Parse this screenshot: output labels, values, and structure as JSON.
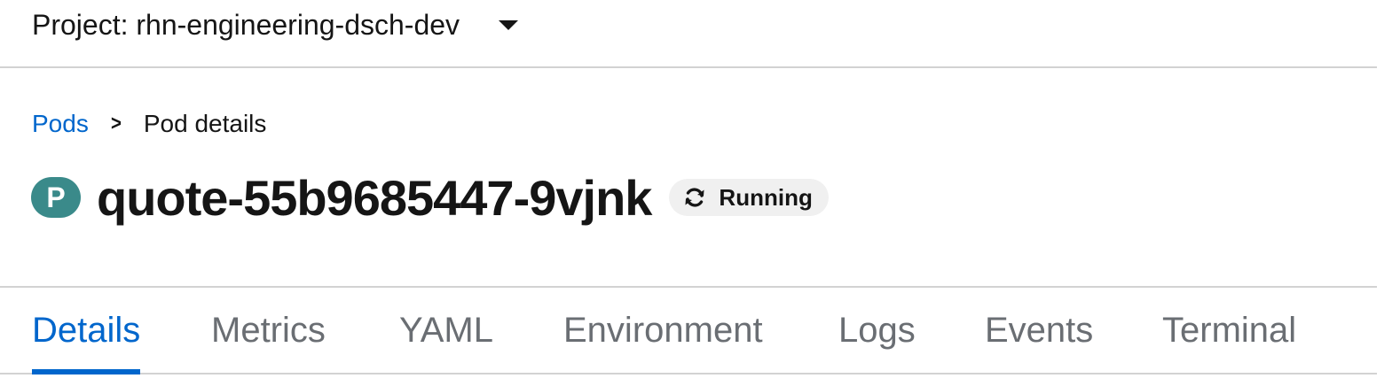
{
  "project": {
    "label": "Project: rhn-engineering-dsch-dev"
  },
  "breadcrumb": {
    "parent": "Pods",
    "current": "Pod details"
  },
  "resource": {
    "badge": "P",
    "name": "quote-55b9685447-9vjnk",
    "status": "Running",
    "badge_color": "#3a8a8a"
  },
  "tabs": [
    {
      "label": "Details",
      "active": true
    },
    {
      "label": "Metrics",
      "active": false
    },
    {
      "label": "YAML",
      "active": false
    },
    {
      "label": "Environment",
      "active": false
    },
    {
      "label": "Logs",
      "active": false
    },
    {
      "label": "Events",
      "active": false
    },
    {
      "label": "Terminal",
      "active": false
    }
  ],
  "colors": {
    "accent": "#0066cc",
    "tab_inactive": "#6a6e73",
    "status_bg": "#f0f0f0"
  }
}
